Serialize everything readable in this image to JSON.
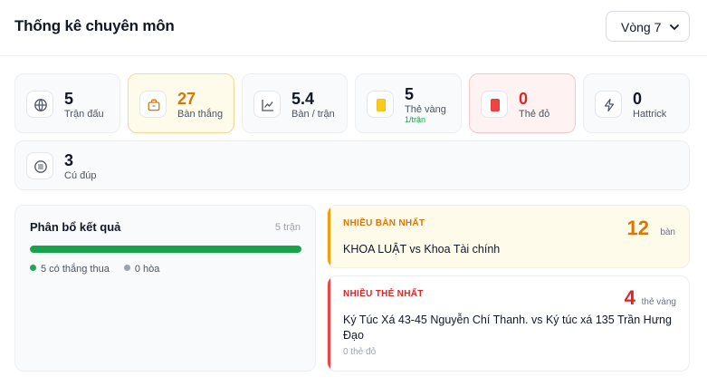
{
  "header": {
    "title": "Thống kê chuyên môn",
    "round_select": "Vòng 7"
  },
  "stats": [
    {
      "value": "5",
      "label": "Trận đấu",
      "icon": "globe-icon"
    },
    {
      "value": "27",
      "label": "Bàn thắng",
      "icon": "bag-icon"
    },
    {
      "value": "5.4",
      "label": "Bàn / trận",
      "icon": "chart-line-icon"
    },
    {
      "value": "5",
      "label": "Thẻ vàng",
      "sub": "1/trận",
      "icon": "yellow-card-icon"
    },
    {
      "value": "0",
      "label": "Thẻ đỏ",
      "icon": "red-card-icon"
    },
    {
      "value": "0",
      "label": "Hattrick",
      "icon": "lightning-icon"
    },
    {
      "value": "3",
      "label": "Cú đúp",
      "icon": "list-circle-icon"
    }
  ],
  "distribution": {
    "title": "Phân bổ kết quả",
    "matches_label": "5 trận",
    "decided_fraction": 1.0,
    "legend_decided": "5 có thắng thua",
    "legend_draw": "0 hòa",
    "colors": {
      "decided": "#16a34a",
      "draw": "#9ca3af"
    }
  },
  "most_goals": {
    "tag": "NHIỀU BÀN NHẤT",
    "match": "KHOA LUẬT vs Khoa Tài chính",
    "value": "12",
    "unit": "bàn",
    "color": "#d97706"
  },
  "most_cards": {
    "tag": "NHIỀU THẺ NHẤT",
    "match": "Ký Túc Xá 43-45 Nguyễn Chí Thanh. vs Ký túc xá 135 Trần Hưng Đạo",
    "value": "4",
    "unit": "thẻ vàng",
    "note": "0 thẻ đỏ",
    "color": "#dc2626"
  }
}
